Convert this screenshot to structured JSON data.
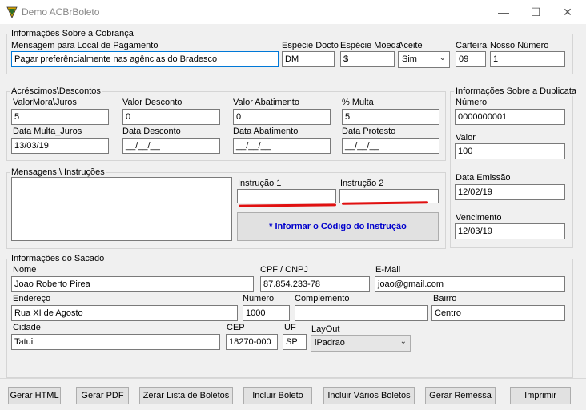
{
  "window": {
    "title": "Demo ACBrBoleto",
    "minimize": "—",
    "maximize": "☐",
    "close": "✕"
  },
  "cobranca": {
    "group_title": "Informações Sobre a Cobrança",
    "local_label": "Mensagem para Local de Pagamento",
    "local_value": "Pagar preferêncialmente nas agências do Bradesco",
    "especie_doc_label": "Espécie Docto",
    "especie_doc_value": "DM",
    "especie_moeda_label": "Espécie Moeda",
    "especie_moeda_value": "$",
    "aceite_label": "Aceite",
    "aceite_value": "Sim",
    "carteira_label": "Carteira",
    "carteira_value": "09",
    "nosso_numero_label": "Nosso Número",
    "nosso_numero_value": "1"
  },
  "acrescimos": {
    "group_title": "Acréscimos\\Descontos",
    "mora_label": "ValorMora\\Juros",
    "mora_value": "5",
    "desconto_label": "Valor Desconto",
    "desconto_value": "0",
    "abatimento_label": "Valor Abatimento",
    "abatimento_value": "0",
    "multa_label": "% Multa",
    "multa_value": "5",
    "data_multa_label": "Data Multa_Juros",
    "data_multa_value": "13/03/19",
    "data_desconto_label": "Data Desconto",
    "data_desconto_value": "__/__/__",
    "data_abatimento_label": "Data Abatimento",
    "data_abatimento_value": "__/__/__",
    "data_protesto_label": "Data Protesto",
    "data_protesto_value": "__/__/__"
  },
  "duplicata": {
    "group_title": "Informações Sobre a Duplicata",
    "numero_label": "Número",
    "numero_value": "0000000001",
    "valor_label": "Valor",
    "valor_value": "100",
    "emissao_label": "Data Emissão",
    "emissao_value": "12/02/19",
    "vencimento_label": "Vencimento",
    "vencimento_value": "12/03/19"
  },
  "mensagens": {
    "group_title": "Mensagens \\ Instruções",
    "instrucao1_label": "Instrução 1",
    "instrucao1_value": "",
    "instrucao2_label": "Instrução 2",
    "instrucao2_value": "",
    "info_button": "* Informar o Código do Instrução"
  },
  "sacado": {
    "group_title": "Informações do Sacado",
    "nome_label": "Nome",
    "nome_value": "Joao Roberto Pirea",
    "cpf_label": "CPF / CNPJ",
    "cpf_value": "87.854.233-78",
    "email_label": "E-Mail",
    "email_value": "joao@gmail.com",
    "endereco_label": "Endereço",
    "endereco_value": "Rua XI de Agosto",
    "numero_label": "Número",
    "numero_value": "1000",
    "complemento_label": "Complemento",
    "complemento_value": "",
    "bairro_label": "Bairro",
    "bairro_value": "Centro",
    "cidade_label": "Cidade",
    "cidade_value": "Tatui",
    "cep_label": "CEP",
    "cep_value": "18270-000",
    "uf_label": "UF",
    "uf_value": "SP",
    "layout_label": "LayOut",
    "layout_value": "lPadrao"
  },
  "buttons": {
    "gerar_html": "Gerar HTML",
    "gerar_pdf": "Gerar PDF",
    "zerar": "Zerar Lista de Boletos",
    "incluir": "Incluir Boleto",
    "incluir_varios": "Incluir Vários Boletos",
    "gerar_remessa": "Gerar Remessa",
    "imprimir": "Imprimir"
  },
  "colors": {
    "annotation": "#e01010",
    "focus_border": "#0078d7",
    "info_text": "#0000cc"
  }
}
